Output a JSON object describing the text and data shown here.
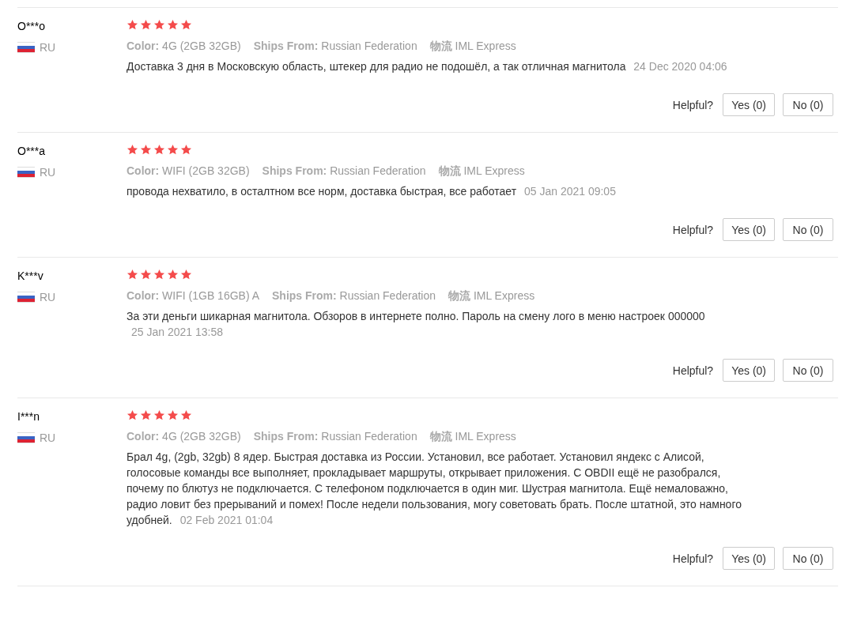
{
  "reviews": [
    {
      "name": "O***o",
      "country": "RU",
      "stars": 5,
      "color_label": "Color:",
      "color_value": "4G (2GB 32GB)",
      "ships_label": "Ships From:",
      "ships_value": "Russian Federation",
      "logistics_label": "物流",
      "logistics_value": "IML Express",
      "text": "Доставка 3 дня в Московскую область, штекер для радио не подошёл, а так отличная магнитола",
      "date": "24 Dec 2020 04:06",
      "helpful": "Helpful?",
      "yes": "Yes (0)",
      "no": "No (0)"
    },
    {
      "name": "O***a",
      "country": "RU",
      "stars": 5,
      "color_label": "Color:",
      "color_value": "WIFI (2GB 32GB)",
      "ships_label": "Ships From:",
      "ships_value": "Russian Federation",
      "logistics_label": "物流",
      "logistics_value": "IML Express",
      "text": "провода нехватило, в осталтном все норм, доставка быстрая, все работает",
      "date": "05 Jan 2021 09:05",
      "helpful": "Helpful?",
      "yes": "Yes (0)",
      "no": "No (0)"
    },
    {
      "name": "K***v",
      "country": "RU",
      "stars": 5,
      "color_label": "Color:",
      "color_value": "WIFI (1GB 16GB) A",
      "ships_label": "Ships From:",
      "ships_value": "Russian Federation",
      "logistics_label": "物流",
      "logistics_value": "IML Express",
      "text": "За эти деньги шикарная магнитола. Обзоров в интернете полно. Пароль на смену лого в меню настроек 000000",
      "date": "25 Jan 2021 13:58",
      "helpful": "Helpful?",
      "yes": "Yes (0)",
      "no": "No (0)"
    },
    {
      "name": "I***n",
      "country": "RU",
      "stars": 5,
      "color_label": "Color:",
      "color_value": "4G (2GB 32GB)",
      "ships_label": "Ships From:",
      "ships_value": "Russian Federation",
      "logistics_label": "物流",
      "logistics_value": "IML Express",
      "text": "Брал 4g, (2gb, 32gb) 8 ядер. Быстрая доставка из России. Установил, все работает. Установил яндекс с Алисой, голосовые команды все выполняет, прокладывает маршруты, открывает приложения. С OBDII ещё не разобрался, почему по блютуз не подключается. С телефоном подключается в один миг. Шустрая магнитола. Ещё немаловажно, радио ловит без прерываний и помех! После недели пользования, могу советовать брать. После штатной, это намного удобней.",
      "date": "02 Feb 2021 01:04",
      "helpful": "Helpful?",
      "yes": "Yes (0)",
      "no": "No (0)"
    }
  ]
}
